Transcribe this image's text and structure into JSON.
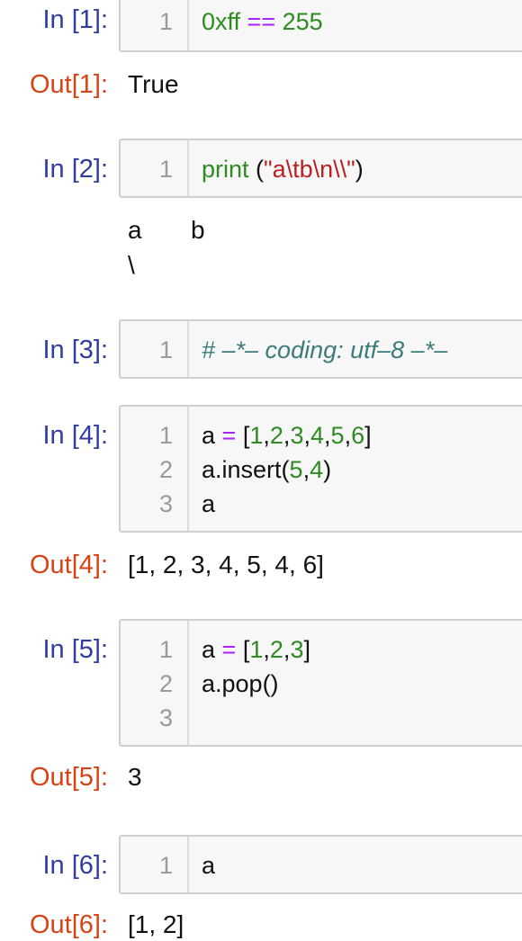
{
  "cells": [
    {
      "in_prompt": "In [1]:",
      "lines": [
        {
          "no": "1",
          "tokens": [
            [
              "0xff",
              "num"
            ],
            [
              " ",
              ""
            ],
            [
              "==",
              "op"
            ],
            [
              " ",
              ""
            ],
            [
              "255",
              "num"
            ]
          ]
        }
      ],
      "out_prompt": "Out[1]:",
      "output": "True"
    },
    {
      "in_prompt": "In [2]:",
      "lines": [
        {
          "no": "1",
          "tokens": [
            [
              "print",
              "kw"
            ],
            [
              " (",
              ""
            ],
            [
              "\"a\\tb\\n\\\\\"",
              "str"
            ],
            [
              ")",
              ""
            ]
          ]
        }
      ],
      "out_prompt": "",
      "output_lines": [
        "a       b",
        "\\"
      ]
    },
    {
      "in_prompt": "In [3]:",
      "lines": [
        {
          "no": "1",
          "tokens": [
            [
              "# –*– coding: utf–8 –*–",
              "comment"
            ]
          ]
        }
      ]
    },
    {
      "in_prompt": "In [4]:",
      "lines": [
        {
          "no": "1",
          "tokens": [
            [
              "a",
              ""
            ],
            [
              " ",
              ""
            ],
            [
              "=",
              "op"
            ],
            [
              " [",
              ""
            ],
            [
              "1",
              "num"
            ],
            [
              ",",
              ""
            ],
            [
              "2",
              "num"
            ],
            [
              ",",
              ""
            ],
            [
              "3",
              "num"
            ],
            [
              ",",
              ""
            ],
            [
              "4",
              "num"
            ],
            [
              ",",
              ""
            ],
            [
              "5",
              "num"
            ],
            [
              ",",
              ""
            ],
            [
              "6",
              "num"
            ],
            [
              "]",
              ""
            ]
          ]
        },
        {
          "no": "2",
          "tokens": [
            [
              "a.insert(",
              ""
            ],
            [
              "5",
              "num"
            ],
            [
              ",",
              ""
            ],
            [
              "4",
              "num"
            ],
            [
              ")",
              ""
            ]
          ]
        },
        {
          "no": "3",
          "tokens": [
            [
              "a",
              ""
            ]
          ]
        }
      ],
      "out_prompt": "Out[4]:",
      "output": "[1, 2, 3, 4, 5, 4, 6]"
    },
    {
      "in_prompt": "In [5]:",
      "lines": [
        {
          "no": "1",
          "tokens": [
            [
              "a",
              ""
            ],
            [
              " ",
              ""
            ],
            [
              "=",
              "op"
            ],
            [
              " [",
              ""
            ],
            [
              "1",
              "num"
            ],
            [
              ",",
              ""
            ],
            [
              "2",
              "num"
            ],
            [
              ",",
              ""
            ],
            [
              "3",
              "num"
            ],
            [
              "]",
              ""
            ]
          ]
        },
        {
          "no": "2",
          "tokens": [
            [
              "a.pop()",
              ""
            ]
          ]
        },
        {
          "no": "3",
          "tokens": []
        }
      ],
      "out_prompt": "Out[5]:",
      "output": "3"
    },
    {
      "in_prompt": "In [6]:",
      "lines": [
        {
          "no": "1",
          "tokens": [
            [
              "a",
              ""
            ]
          ]
        }
      ],
      "out_prompt": "Out[6]:",
      "output": "[1, 2]"
    }
  ]
}
